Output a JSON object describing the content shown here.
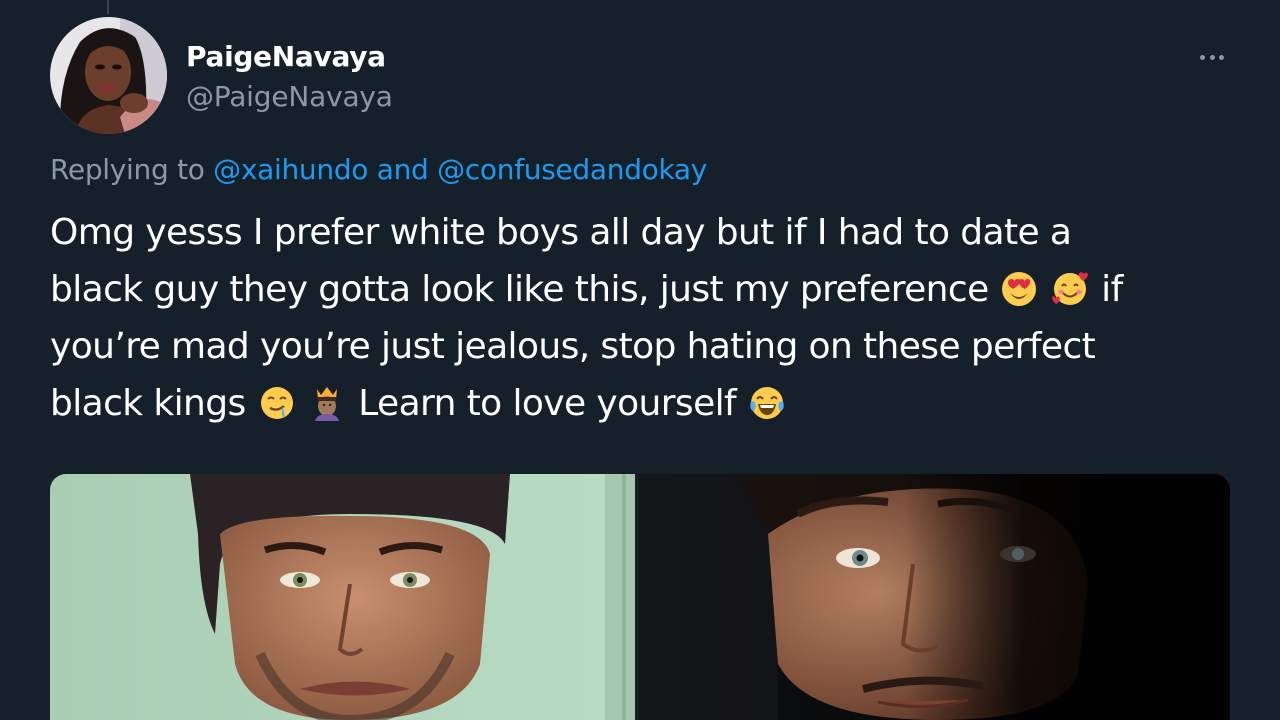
{
  "tweet": {
    "author": {
      "display_name": "PaigeNavaya",
      "handle": "@PaigeNavaya"
    },
    "replying_prefix": "Replying to",
    "reply_mention_1": "@xaihundo",
    "reply_conjunction": "and",
    "reply_mention_2": "@confusedandokay",
    "text": {
      "line1": "Omg yesss I prefer white boys all day but if I had to date a",
      "line2_a": "black guy they gotta look like this, just my preference",
      "line2_b": "if",
      "line3": "you’re mad you’re just jealous, stop hating on these perfect",
      "line4_a": "black kings",
      "line4_b": "Learn to love yourself"
    },
    "emojis": [
      "heart-eyes-emoji",
      "smiling-face-with-hearts-emoji",
      "drooling-face-emoji",
      "prince-emoji",
      "tears-of-joy-emoji"
    ],
    "media_count": 2
  },
  "colors": {
    "background": "#15202b",
    "primary_text": "#ffffff",
    "secondary_text": "#8b98a5",
    "link": "#1d9bf0"
  }
}
